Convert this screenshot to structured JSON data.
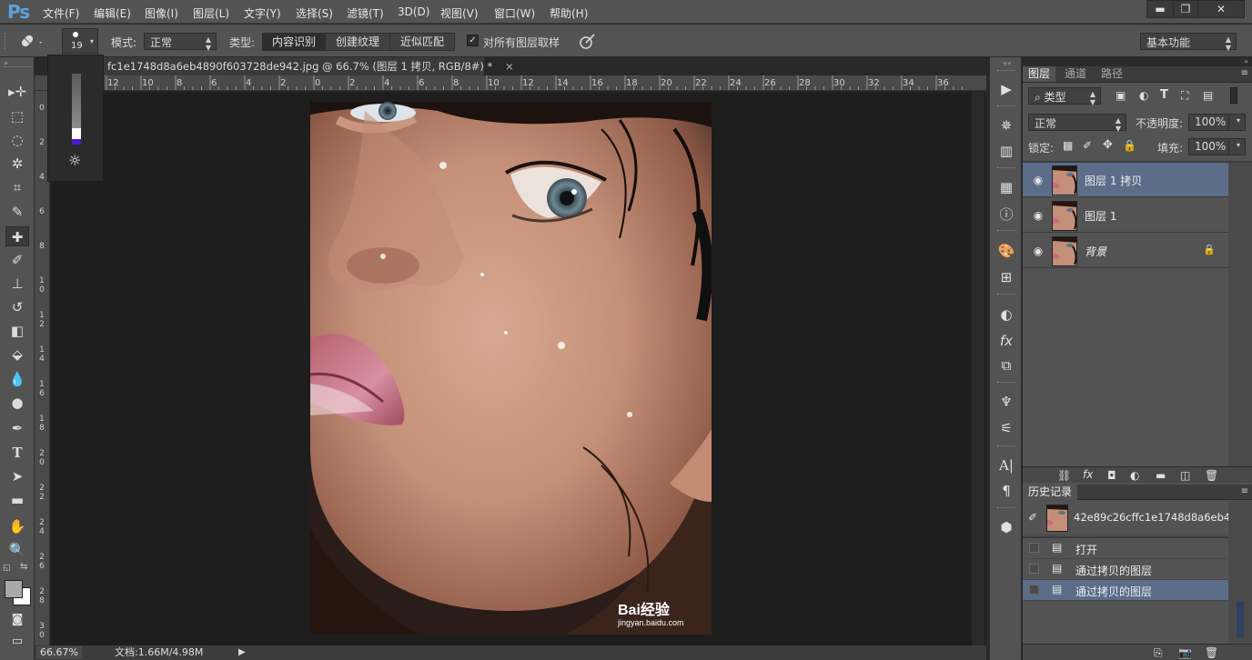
{
  "app": {
    "logo": "Ps"
  },
  "menu": [
    "文件(F)",
    "编辑(E)",
    "图像(I)",
    "图层(L)",
    "文字(Y)",
    "选择(S)",
    "滤镜(T)",
    "3D(D)",
    "视图(V)",
    "窗口(W)",
    "帮助(H)"
  ],
  "window_buttons": {
    "minimize": "▬",
    "restore": "❐",
    "close": "✕"
  },
  "options": {
    "brush_size": "19",
    "mode_label": "模式:",
    "mode_value": "正常",
    "type_label": "类型:",
    "type_options": [
      "内容识别",
      "创建纹理",
      "近似匹配"
    ],
    "sample_all_label": "对所有图层取样",
    "sample_all_checked": true,
    "workspace": "基本功能"
  },
  "document": {
    "tab_title": "fc1e1748d8a6eb4890f603728de942.jpg @ 66.7% (图层 1 拷贝, RGB/8#) *",
    "tab_close": "×"
  },
  "ruler": {
    "top": [
      "12",
      "10",
      "8",
      "6",
      "4",
      "2",
      "0",
      "2",
      "4",
      "6",
      "8",
      "10",
      "12",
      "14",
      "16",
      "18",
      "20",
      "22",
      "24",
      "26",
      "28",
      "30",
      "32",
      "34",
      "36"
    ],
    "left": [
      "0",
      "2",
      "4",
      "6",
      "8",
      "10",
      "12",
      "14",
      "16",
      "18",
      "20",
      "22",
      "24",
      "26",
      "28",
      "30"
    ]
  },
  "status": {
    "zoom": "66.67%",
    "doc_info": "文档:1.66M/4.98M"
  },
  "watermark": {
    "brand": "Bai经验",
    "url": "jingyan.baidu.com"
  },
  "layers_panel": {
    "tabs": [
      "图层",
      "通道",
      "路径"
    ],
    "filter_kind": "类型",
    "blend_mode": "正常",
    "opacity_label": "不透明度:",
    "opacity_value": "100%",
    "lock_label": "锁定:",
    "fill_label": "填充:",
    "fill_value": "100%",
    "layers": [
      {
        "name": "图层 1 拷贝",
        "selected": true
      },
      {
        "name": "图层 1",
        "selected": false
      },
      {
        "name": "背景",
        "selected": false,
        "locked": true
      }
    ]
  },
  "history_panel": {
    "title": "历史记录",
    "snapshot_name": "42e89c26cffc1e1748d8a6eb4...",
    "states": [
      {
        "name": "打开",
        "selected": false
      },
      {
        "name": "通过拷贝的图层",
        "selected": false
      },
      {
        "name": "通过拷贝的图层",
        "selected": true
      }
    ]
  },
  "colors": {
    "selection": "#5c6d8a",
    "ps_blue": "#5ba3e0",
    "chrome": "#535353",
    "canvas_bg": "#1e1e1e"
  }
}
